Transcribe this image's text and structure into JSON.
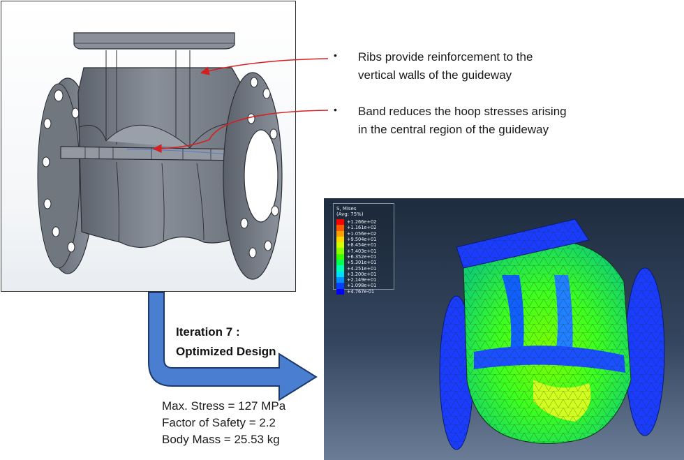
{
  "callouts": [
    {
      "line1": "Ribs provide reinforcement to the",
      "line2": "vertical walls of the guideway"
    },
    {
      "line1": "Band reduces the hoop stresses arising",
      "line2": "in the central region of the guideway"
    }
  ],
  "iteration": {
    "line1": "Iteration 7 :",
    "line2": "Optimized Design"
  },
  "metrics": {
    "max_stress": "Max. Stress = 127 MPa",
    "safety_factor": "Factor of Safety = 2.2",
    "body_mass": "Body Mass = 25.53 kg"
  },
  "legend": {
    "title": "S, Mises",
    "subtitle": "(Avg: 75%)",
    "entries": [
      {
        "value": "+1.266e+02",
        "color": "#ff0000"
      },
      {
        "value": "+1.161e+02",
        "color": "#ff5a00"
      },
      {
        "value": "+1.056e+02",
        "color": "#ffa000"
      },
      {
        "value": "+9.504e+01",
        "color": "#ffd800"
      },
      {
        "value": "+8.454e+01",
        "color": "#d4ff00"
      },
      {
        "value": "+7.403e+01",
        "color": "#8cff00"
      },
      {
        "value": "+6.352e+01",
        "color": "#3cff00"
      },
      {
        "value": "+5.301e+01",
        "color": "#00ff50"
      },
      {
        "value": "+4.251e+01",
        "color": "#00ffb0"
      },
      {
        "value": "+3.200e+01",
        "color": "#00e0ff"
      },
      {
        "value": "+2.149e+01",
        "color": "#0090ff"
      },
      {
        "value": "+1.098e+01",
        "color": "#0040ff"
      },
      {
        "value": "+4.767e-01",
        "color": "#0000ff"
      }
    ]
  },
  "colors": {
    "callout_arrow": "#d42020",
    "flow_arrow_fill": "#4a7ed0",
    "flow_arrow_outline": "#1b3a6b",
    "cad_body": "#7f858f"
  }
}
